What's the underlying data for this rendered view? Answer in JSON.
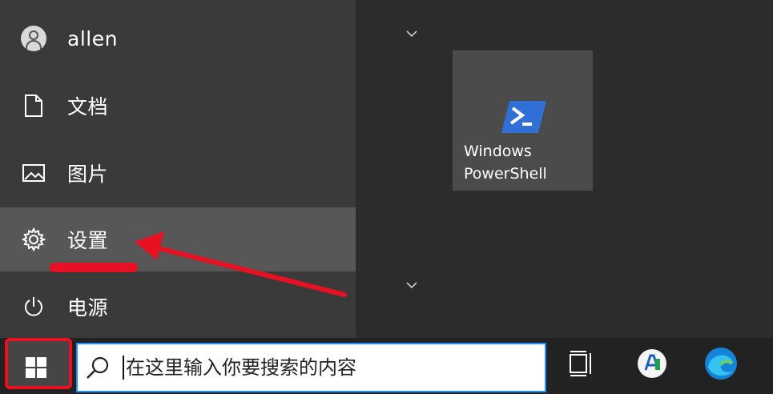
{
  "user": {
    "name": "allen"
  },
  "menu": {
    "documents": "文档",
    "pictures": "图片",
    "settings": "设置",
    "power": "电源"
  },
  "tile": {
    "line1": "Windows",
    "line2": "PowerShell"
  },
  "search": {
    "placeholder": "在这里输入你要搜索的内容"
  },
  "colors": {
    "annotation_red": "#e81123",
    "search_border": "#1e90ff",
    "powershell_blue": "#2f6fd6"
  },
  "icons": {
    "start": "windows-logo-icon",
    "search": "search-icon",
    "task_view": "task-view-icon",
    "app": "ai-app-icon",
    "edge": "edge-icon"
  }
}
